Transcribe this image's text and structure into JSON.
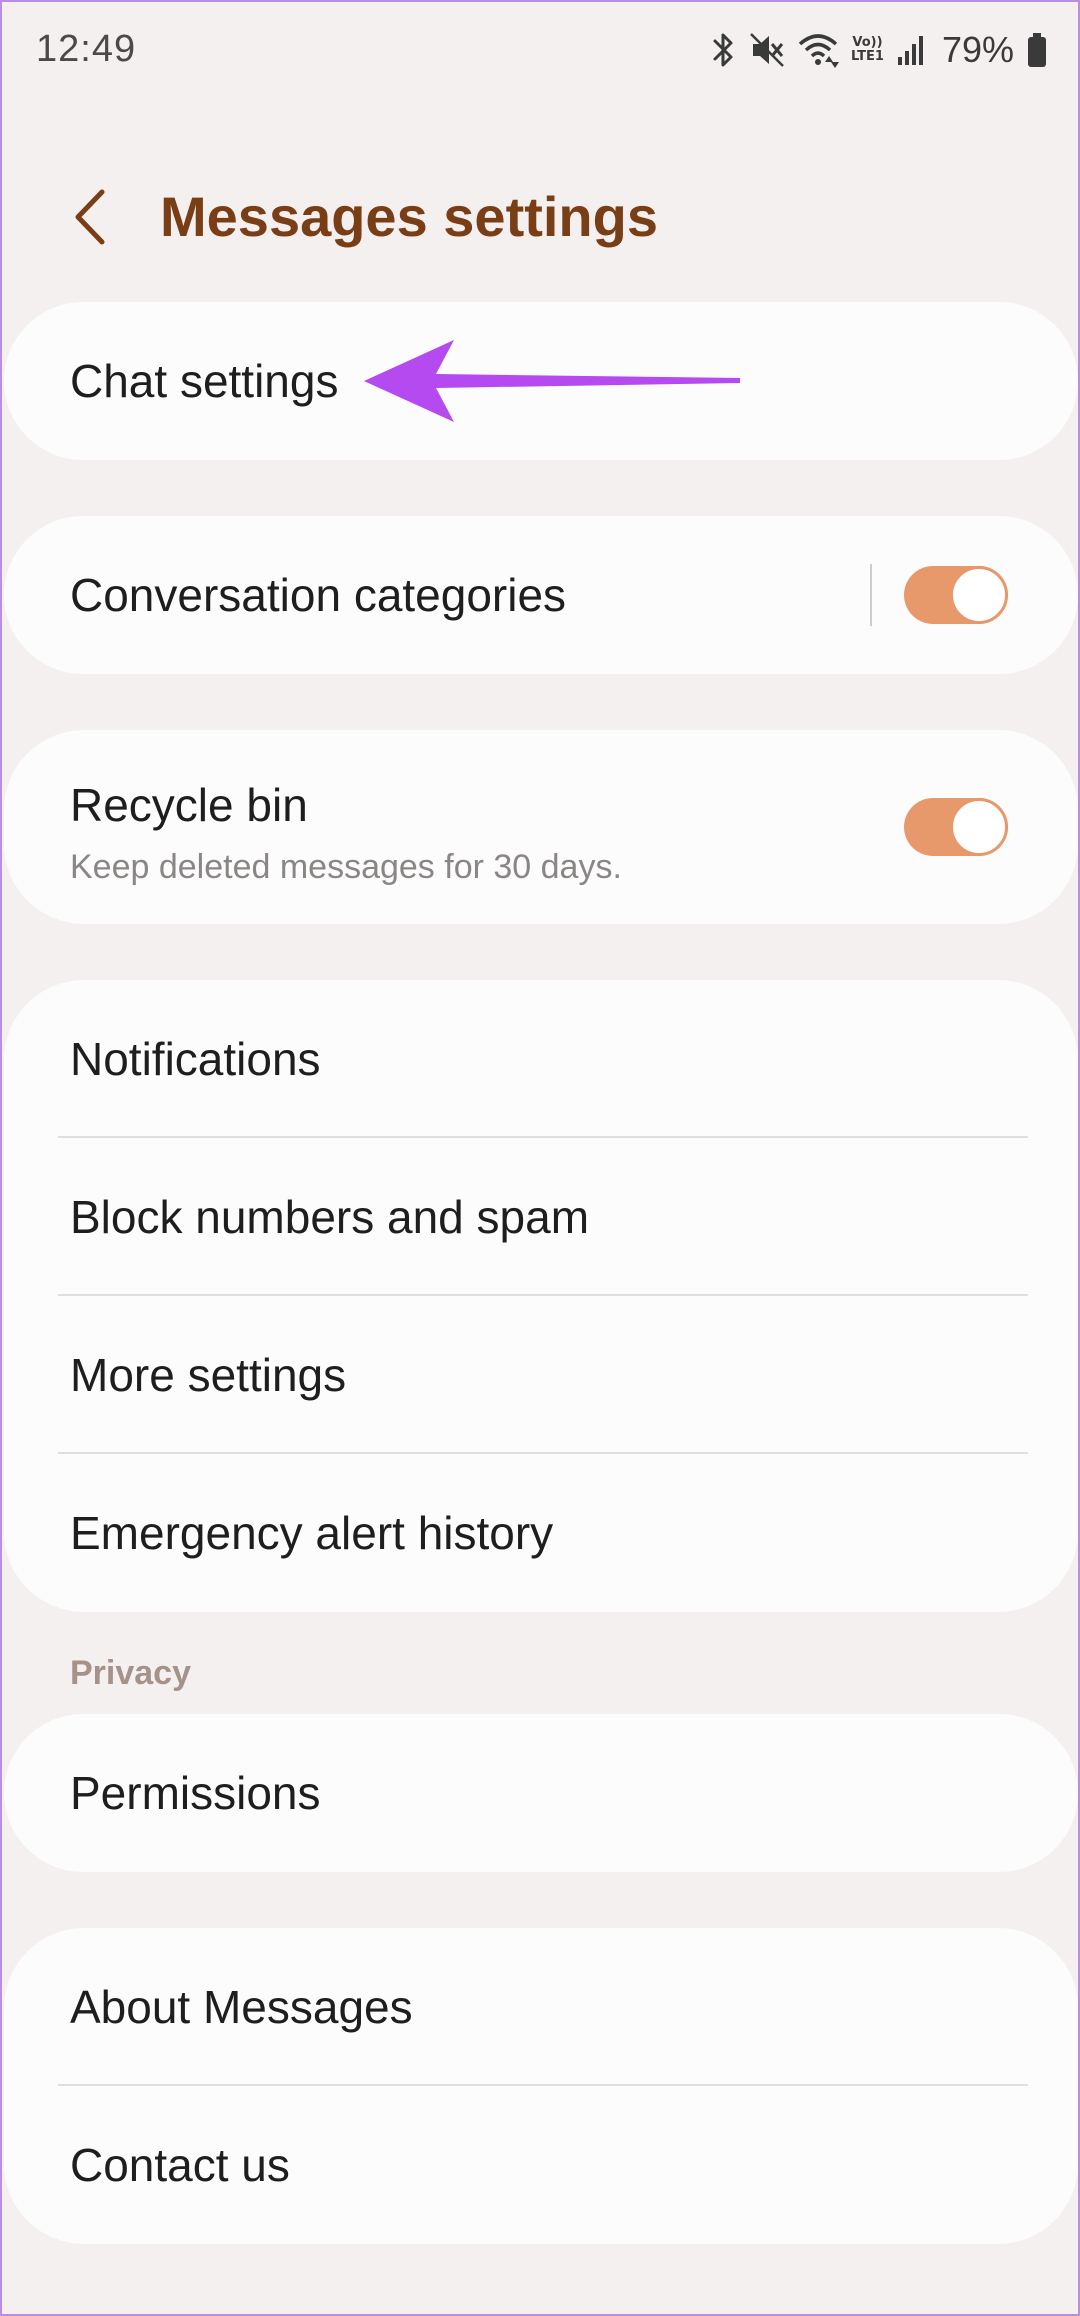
{
  "status_bar": {
    "time": "12:49",
    "battery": "79%",
    "network": "LTE1",
    "volte": "Vo))",
    "icons": [
      "bluetooth-icon",
      "mute-icon",
      "wifi-icon",
      "signal-icon",
      "battery-icon"
    ]
  },
  "header": {
    "back_icon": "chevron-left-icon",
    "title": "Messages settings"
  },
  "groups": [
    {
      "items": [
        {
          "label": "Chat settings"
        }
      ]
    },
    {
      "items": [
        {
          "label": "Conversation categories",
          "toggle": true
        }
      ]
    },
    {
      "items": [
        {
          "label": "Recycle bin",
          "subtitle": "Keep deleted messages for 30 days.",
          "toggle": true
        }
      ]
    },
    {
      "items": [
        {
          "label": "Notifications"
        },
        {
          "label": "Block numbers and spam"
        },
        {
          "label": "More settings"
        },
        {
          "label": "Emergency alert history"
        }
      ]
    },
    {
      "section": "Privacy",
      "items": [
        {
          "label": "Permissions"
        }
      ]
    },
    {
      "items": [
        {
          "label": "About Messages"
        },
        {
          "label": "Contact us"
        }
      ]
    }
  ],
  "colors": {
    "background": "#f4f0ef",
    "card": "#fdfcfc",
    "title": "#7a3e16",
    "toggle_on": "#e8996b",
    "section_label": "#a5928b",
    "annotation_arrow": "#b44af0"
  }
}
